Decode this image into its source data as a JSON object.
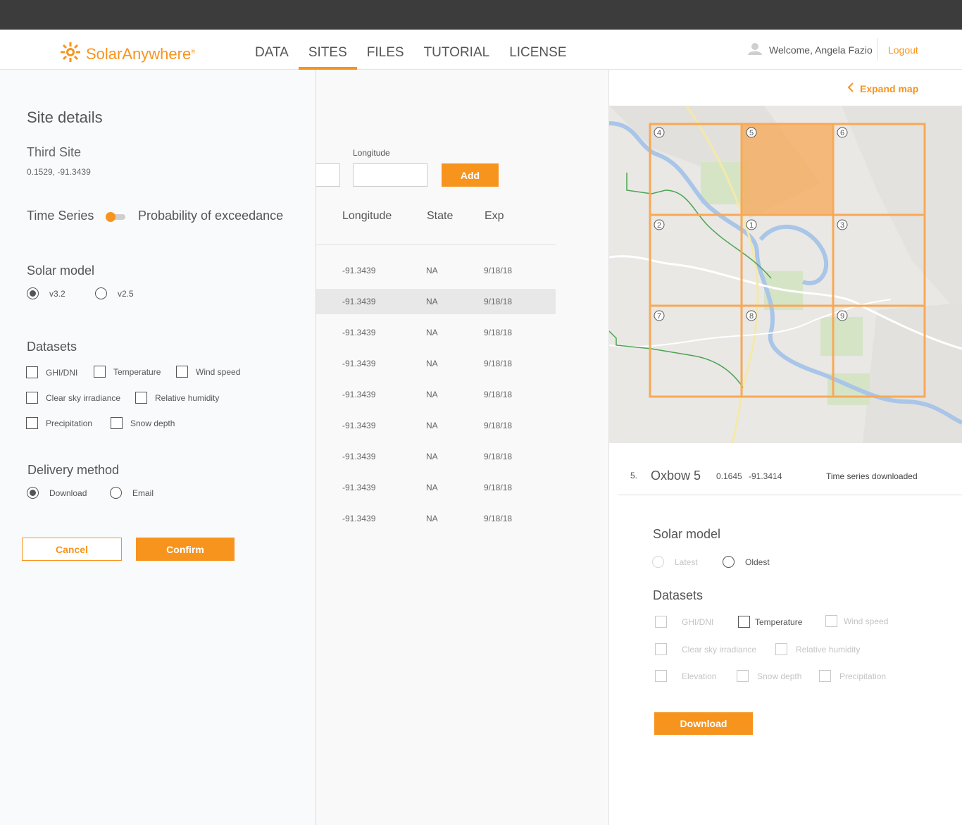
{
  "brand": {
    "name": "SolarAnywhere",
    "reg": "®",
    "accent": "#f7941d"
  },
  "nav": {
    "items": [
      "DATA",
      "SITES",
      "FILES",
      "TUTORIAL",
      "LICENSE"
    ],
    "active": "SITES"
  },
  "user": {
    "welcome": "Welcome, Angela Fazio",
    "logout": "Logout"
  },
  "sites": {
    "longitude_label": "Longitude",
    "add_label": "Add",
    "columns": [
      "Longitude",
      "State",
      "Exp"
    ],
    "rows": [
      {
        "longitude": "-91.3439",
        "state": "NA",
        "exp": "9/18/18"
      },
      {
        "longitude": "-91.3439",
        "state": "NA",
        "exp": "9/18/18"
      },
      {
        "longitude": "-91.3439",
        "state": "NA",
        "exp": "9/18/18"
      },
      {
        "longitude": "-91.3439",
        "state": "NA",
        "exp": "9/18/18"
      },
      {
        "longitude": "-91.3439",
        "state": "NA",
        "exp": "9/18/18"
      },
      {
        "longitude": "-91.3439",
        "state": "NA",
        "exp": "9/18/18"
      },
      {
        "longitude": "-91.3439",
        "state": "NA",
        "exp": "9/18/18"
      },
      {
        "longitude": "-91.3439",
        "state": "NA",
        "exp": "9/18/18"
      },
      {
        "longitude": "-91.3439",
        "state": "NA",
        "exp": "9/18/18"
      }
    ]
  },
  "panel": {
    "title": "Site details",
    "site_name": "Third Site",
    "site_coords": "0.1529, -91.3439",
    "time_series": "Time Series",
    "poe": "Probability of exceedance",
    "solar_model": {
      "heading": "Solar model",
      "options": [
        "v3.2",
        "v2.5"
      ],
      "selected": "v3.2"
    },
    "datasets": {
      "heading": "Datasets",
      "items": [
        "GHI/DNI",
        "Temperature",
        "Wind speed",
        "Clear sky irradiance",
        "Relative humidity",
        "Precipitation",
        "Snow depth"
      ]
    },
    "delivery": {
      "heading": "Delivery method",
      "options": [
        "Download",
        "Email"
      ],
      "selected": "Download"
    },
    "cancel": "Cancel",
    "confirm": "Confirm"
  },
  "map": {
    "expand": "Expand map",
    "grid_labels": [
      "4",
      "5",
      "6",
      "2",
      "1",
      "3",
      "7",
      "8",
      "9"
    ],
    "selected_cell": "5"
  },
  "site_summary": {
    "num": "5.",
    "name": "Oxbow 5",
    "lat": "0.1645",
    "lon": "-91.3414",
    "status": "Time series downloaded"
  },
  "download_panel": {
    "solar_model": {
      "heading": "Solar model",
      "options": [
        "Latest",
        "Oldest"
      ]
    },
    "datasets": {
      "heading": "Datasets",
      "items": [
        "GHI/DNI",
        "Temperature",
        "Wind speed",
        "Clear sky irradiance",
        "Relative humidity",
        "Elevation",
        "Snow depth",
        "Precipitation"
      ]
    },
    "download": "Download"
  }
}
